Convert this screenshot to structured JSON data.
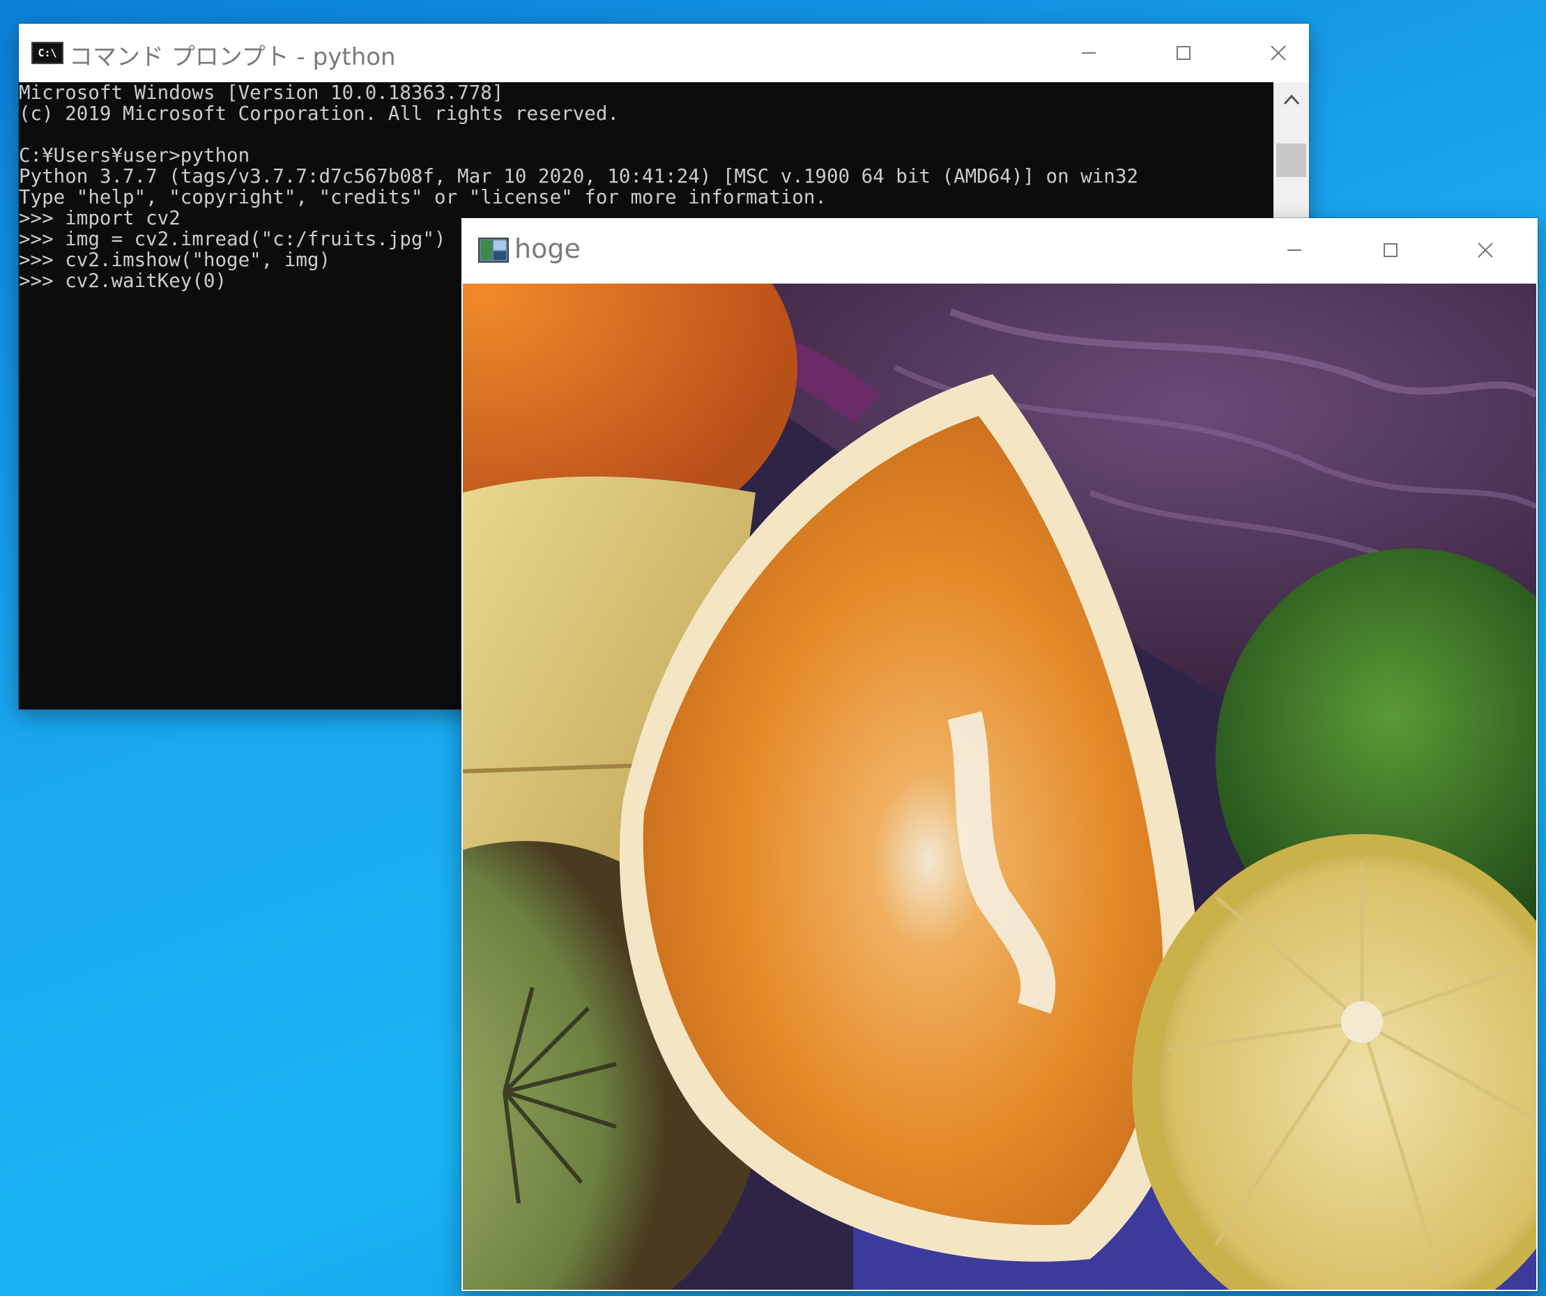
{
  "cmd_window": {
    "title": "コマンド プロンプト - python",
    "icon_label": "C:\\",
    "console_lines": [
      "Microsoft Windows [Version 10.0.18363.778]",
      "(c) 2019 Microsoft Corporation. All rights reserved.",
      "",
      "C:¥Users¥user>python",
      "Python 3.7.7 (tags/v3.7.7:d7c567b08f, Mar 10 2020, 10:41:24) [MSC v.1900 64 bit (AMD64)] on win32",
      "Type \"help\", \"copyright\", \"credits\" or \"license\" for more information.",
      ">>> import cv2",
      ">>> img = cv2.imread(\"c:/fruits.jpg\")",
      ">>> cv2.imshow(\"hoge\", img)",
      ">>> cv2.waitKey(0)"
    ]
  },
  "image_window": {
    "title": "hoge",
    "image_subject": "fruits.jpg — orange wedge, banana, red cabbage, lime, lemon, kiwi"
  },
  "colors": {
    "console_bg": "#0c0c0c",
    "console_text": "#cccccc",
    "desktop_blue": "#19b4f4"
  }
}
